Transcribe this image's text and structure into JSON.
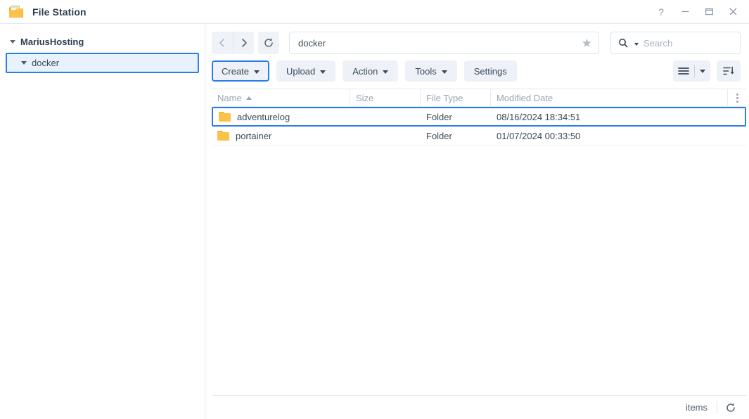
{
  "window": {
    "title": "File Station",
    "icon": "folder-icon",
    "controls": [
      {
        "name": "help-button",
        "glyph": "?"
      },
      {
        "name": "minimize-button",
        "glyph": "minimize-icon"
      },
      {
        "name": "maximize-button",
        "glyph": "maximize-icon"
      },
      {
        "name": "close-button",
        "glyph": "close-icon"
      }
    ]
  },
  "sidebar": {
    "root": {
      "label": "MariusHosting",
      "expanded": true
    },
    "child": {
      "label": "docker",
      "expanded": true,
      "selected": true
    }
  },
  "navigation": {
    "back_icon": "chevron-left-icon",
    "forward_icon": "chevron-right-icon",
    "refresh_icon": "refresh-icon",
    "path_value": "docker",
    "favorite_icon": "star-icon",
    "search_icon": "search-icon",
    "search_value": "",
    "search_placeholder": "Search"
  },
  "toolbar": {
    "buttons": [
      {
        "label": "Create",
        "dropdown": true,
        "primary": true,
        "name": "create-button"
      },
      {
        "label": "Upload",
        "dropdown": true,
        "primary": false,
        "name": "upload-button"
      },
      {
        "label": "Action",
        "dropdown": true,
        "primary": false,
        "name": "action-button"
      },
      {
        "label": "Tools",
        "dropdown": true,
        "primary": false,
        "name": "tools-button"
      },
      {
        "label": "Settings",
        "dropdown": false,
        "primary": false,
        "name": "settings-button"
      }
    ],
    "view_icon": "list-view-icon",
    "view_dropdown_icon": "chevron-down-icon",
    "sort_icon": "sort-descending-icon"
  },
  "file_list": {
    "columns": [
      {
        "label": "Name",
        "sort": "asc"
      },
      {
        "label": "Size",
        "sort": ""
      },
      {
        "label": "File Type",
        "sort": ""
      },
      {
        "label": "Modified Date",
        "sort": ""
      }
    ],
    "column_menu_icon": "kebab-menu-icon",
    "rows": [
      {
        "icon": "folder-icon",
        "name": "adventurelog",
        "size": "",
        "type": "Folder",
        "modified": "08/16/2024 18:34:51",
        "selected": true
      },
      {
        "icon": "folder-icon",
        "name": "portainer",
        "size": "",
        "type": "Folder",
        "modified": "01/07/2024 00:33:50",
        "selected": false
      }
    ]
  },
  "statusbar": {
    "items_label": "items",
    "refresh_icon": "refresh-icon"
  },
  "colors": {
    "accent": "#2b7de9",
    "folder": "#fbc24a",
    "button_bg": "#eef2f8",
    "text": "#3c4858",
    "muted": "#9aa5b1"
  }
}
